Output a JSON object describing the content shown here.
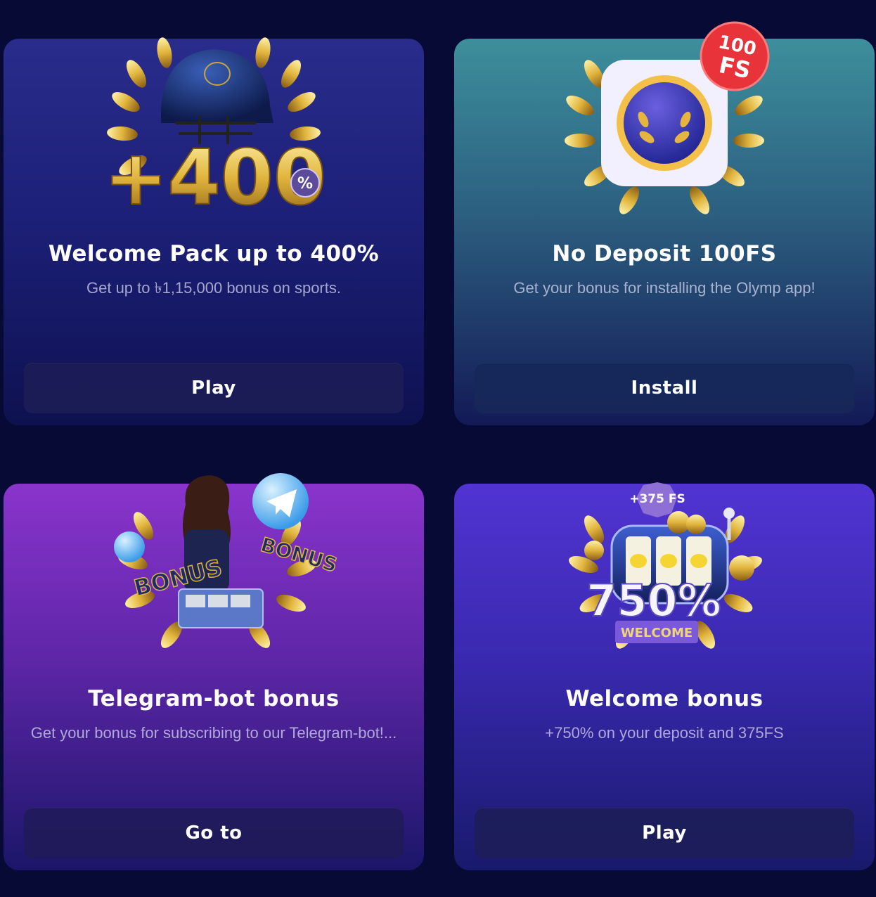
{
  "cards": [
    {
      "title": "Welcome Pack up to 400%",
      "description": "Get up to ৳1,15,000 bonus on sports.",
      "button_label": "Play",
      "art_text": "+400",
      "icon": "cricket-helmet-laurel-icon"
    },
    {
      "title": "No Deposit 100FS",
      "description": "Get your bonus for installing the Olymp app!",
      "button_label": "Install",
      "art_text": "100 FS",
      "icon": "app-icon-laurel-icon"
    },
    {
      "title": "Telegram-bot bonus",
      "description": "Get your bonus for subscribing to our Telegram-bot!...",
      "button_label": "Go to",
      "art_text": "BONUS",
      "icon": "telegram-bonus-laurel-icon"
    },
    {
      "title": "Welcome bonus",
      "description": "+750% on your deposit and 375FS",
      "button_label": "Play",
      "art_text": "750%",
      "art_subtext": "WELCOME",
      "art_badge": "+375 FS",
      "icon": "slot-machine-laurel-icon"
    }
  ],
  "colors": {
    "page_bg": "#080a36",
    "gold": "#d9b23a",
    "button_bg": "#1c1e56"
  }
}
